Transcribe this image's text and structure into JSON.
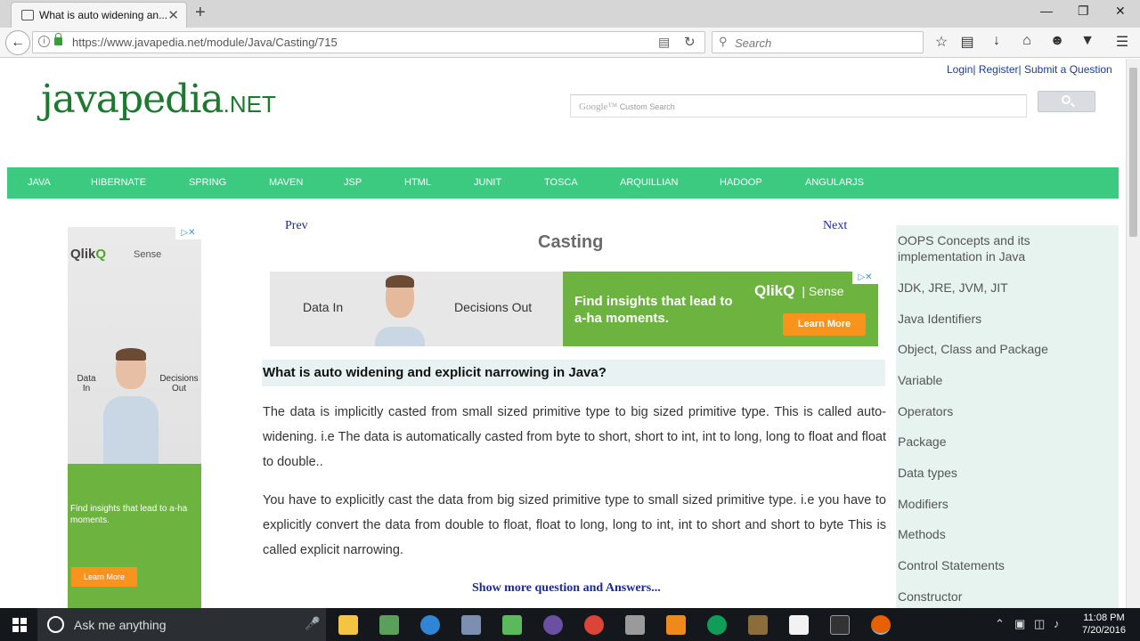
{
  "browser": {
    "tab_title": "What is auto widening an...",
    "tab_close": "✕",
    "new_tab": "+",
    "url": "https://www.javapedia.net/module/Java/Casting/715",
    "search_placeholder": "Search"
  },
  "page": {
    "top_links": {
      "login": "Login",
      "register": "Register",
      "submit": "Submit a Question",
      "sep": "|"
    },
    "logo": {
      "main": "javapedia",
      "suffix": ".NET"
    },
    "custom_search": {
      "brand": "Google™",
      "label": "Custom Search"
    },
    "menu": [
      "JAVA",
      "HIBERNATE",
      "SPRING",
      "MAVEN",
      "JSP",
      "HTML",
      "JUNIT",
      "TOSCA",
      "ARQUILLIAN",
      "HADOOP",
      "ANGULARJS"
    ],
    "left_ad": {
      "brand": "Qlik",
      "brand_mark": "Q",
      "sense": "Sense",
      "data_in": "Data In",
      "decisions_out": "Decisions Out",
      "tagline": "Find insights that lead to a-ha moments.",
      "cta": "Learn More",
      "adchoice": "▷✕"
    },
    "nav": {
      "prev": "Prev",
      "next": "Next"
    },
    "title": "Casting",
    "banner_ad": {
      "data_in": "Data In",
      "decisions_out": "Decisions Out",
      "tagline": "Find insights that lead to a-ha moments.",
      "brand": "Qlik",
      "brand_mark": "Q",
      "sense": "| Sense",
      "cta": "Learn More",
      "adchoice": "▷✕"
    },
    "question": "What is auto widening and explicit narrowing in Java?",
    "answer_p1": "The data is implicitly casted from small sized primitive type to big sized primitive type. This is called auto-widening. i.e The data is automatically casted from byte to short, short to int, int to long, long to float and float to double..",
    "answer_p2": "You have to explicitly cast the data from big sized primitive type to small sized primitive type. i.e you have to explicitly convert the data from double to float, float to long, long to int, int to short and short to byte This is called explicit narrowing.",
    "show_more": "Show more question and Answers...",
    "sidebar": [
      "OOPS Concepts and its implementation in Java",
      "JDK, JRE, JVM, JIT",
      "Java Identifiers",
      "Object, Class and Package",
      "Variable",
      "Operators",
      "Package",
      "Data types",
      "Modifiers",
      "Methods",
      "Control Statements",
      "Constructor"
    ]
  },
  "taskbar": {
    "search_text": "Ask me anything",
    "time": "11:08 PM",
    "date": "7/20/2016"
  }
}
